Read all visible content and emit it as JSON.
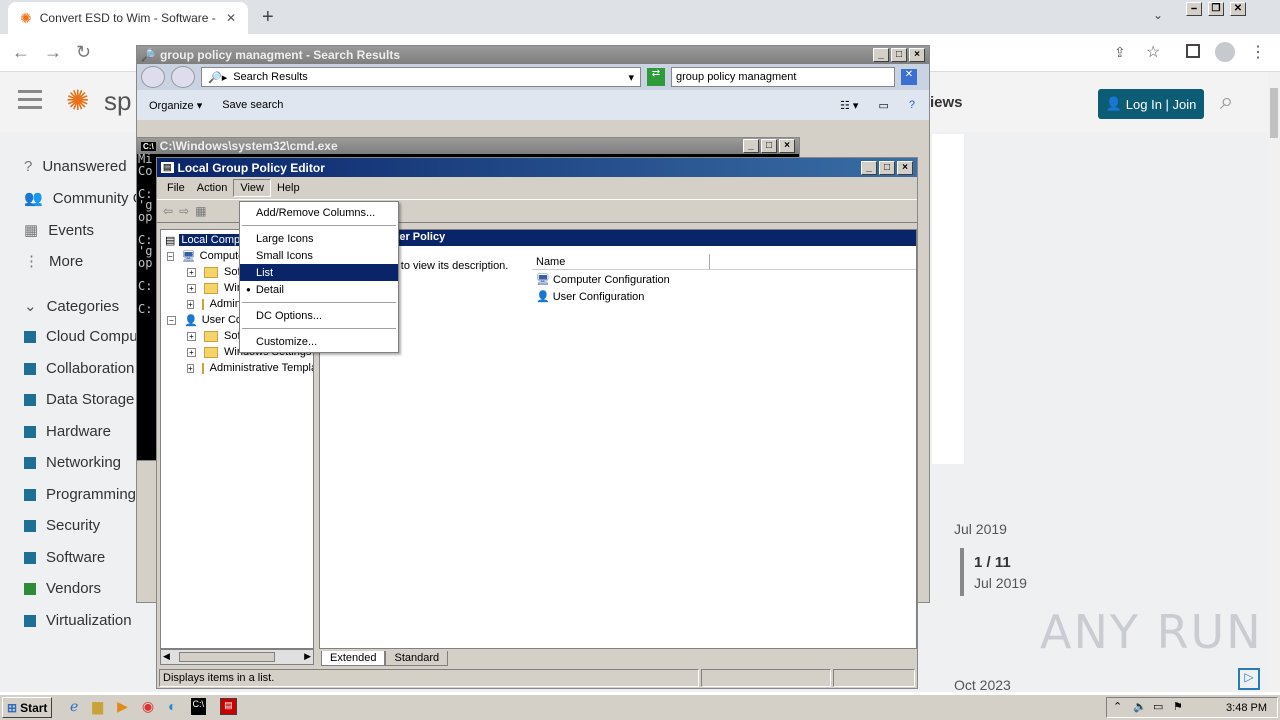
{
  "browser": {
    "tab_title": "Convert ESD to Wim - Software - Sp",
    "new_tab": "+",
    "minimize": "⎯",
    "restore": "❐",
    "close": "✕"
  },
  "site": {
    "logo_text": "sp",
    "header_partial": "iews",
    "login_label": "Log In | Join",
    "sidebar": [
      {
        "label": "Unanswered",
        "icon": "question-icon"
      },
      {
        "label": "Community G",
        "icon": "community-icon"
      },
      {
        "label": "Events",
        "icon": "calendar-icon"
      },
      {
        "label": "More",
        "icon": "more-icon"
      }
    ],
    "categories_heading": "Categories",
    "categories": [
      {
        "label": "Cloud Compu",
        "color": "#1f6f95"
      },
      {
        "label": "Collaboration",
        "color": "#1f6f95"
      },
      {
        "label": "Data Storage",
        "color": "#1f6f95"
      },
      {
        "label": "Hardware",
        "color": "#1f6f95"
      },
      {
        "label": "Networking",
        "color": "#1f6f95"
      },
      {
        "label": "Programming",
        "color": "#1f6f95"
      },
      {
        "label": "Security",
        "color": "#1f6f95"
      },
      {
        "label": "Software",
        "color": "#1f6f95"
      },
      {
        "label": "Vendors",
        "color": "#2e8b3a"
      },
      {
        "label": "Virtualization",
        "color": "#1f6f95"
      }
    ],
    "timeline": {
      "top_date": "Jul 2019",
      "position": "1 / 11",
      "position_date": "Jul 2019",
      "bottom_date": "Oct 2023"
    },
    "watermark": "ANY RUN"
  },
  "search_window": {
    "title": "group policy managment - Search Results",
    "address": "Search Results",
    "search_value": "group policy managment",
    "organize": "Organize",
    "save_search": "Save search"
  },
  "cmd_window": {
    "title": "C:\\Windows\\system32\\cmd.exe",
    "lines": [
      "Mi",
      "Co",
      "",
      "C:",
      "'g",
      "op",
      "",
      "C:",
      "'g",
      "op",
      "",
      "C:",
      "",
      "C:"
    ]
  },
  "gpedit": {
    "title": "Local Group Policy Editor",
    "menu": [
      "File",
      "Action",
      "View",
      "Help"
    ],
    "view_menu": [
      {
        "label": "Add/Remove Columns...",
        "sep_after": true
      },
      {
        "label": "Large Icons"
      },
      {
        "label": "Small Icons"
      },
      {
        "label": "List",
        "selected": true
      },
      {
        "label": "Detail",
        "bullet": "●",
        "sep_after": true
      },
      {
        "label": "DC Options...",
        "sep_after": true
      },
      {
        "label": "Customize..."
      }
    ],
    "tree": [
      {
        "label": "Local Computer Policy",
        "indent": 0,
        "selected": true
      },
      {
        "label": "Computer Configuration",
        "indent": 1
      },
      {
        "label": "Software Settings",
        "indent": 2
      },
      {
        "label": "Windows Settings",
        "indent": 2
      },
      {
        "label": "Administrative Templates",
        "indent": 2
      },
      {
        "label": "User Configuration",
        "indent": 1
      },
      {
        "label": "Software Settings",
        "indent": 2
      },
      {
        "label": "Windows Settings",
        "indent": 2
      },
      {
        "label": "Administrative Templates",
        "indent": 2
      }
    ],
    "right_header": "Local Computer Policy",
    "description_hint": "Select an item to view its description.",
    "column_name": "Name",
    "items": [
      "Computer Configuration",
      "User Configuration"
    ],
    "tabs": [
      "Extended",
      "Standard"
    ],
    "status": "Displays items in a list."
  },
  "taskbar": {
    "start": "Start",
    "time": "3:48 PM"
  }
}
